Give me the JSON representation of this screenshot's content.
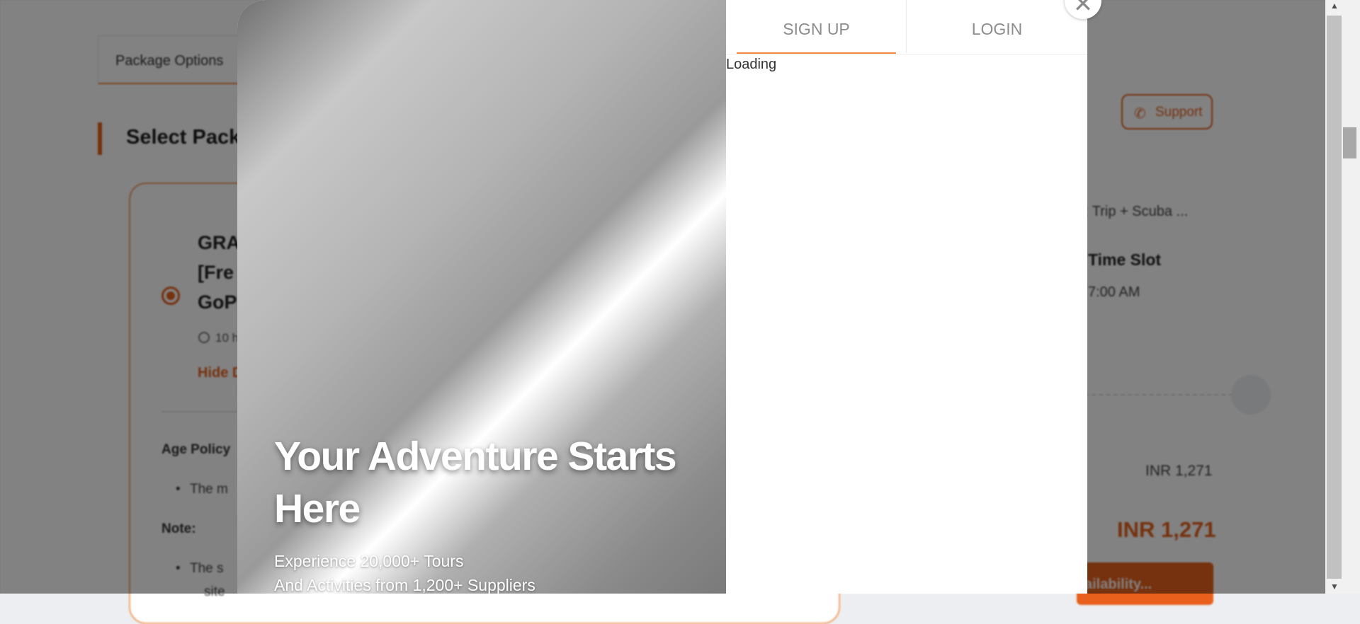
{
  "background_page": {
    "tab_label": "Package Options",
    "section_title": "Select Pack",
    "package_title": "GRA\n[Fre\nGoP",
    "duration": "10 h",
    "hide_link": "Hide D",
    "age_policy_heading": "Age Policy",
    "age_policy_item": "The m",
    "note_heading": "Note:",
    "note_item": "The s",
    "note_item_cont": "site",
    "support_label": "Support",
    "package_name_truncated": ": Trip + Scuba ...",
    "time_slot_heading": "Time Slot",
    "time_slot_value": "7:00 AM",
    "price_line": "INR 1,271",
    "price_total": "INR 1,271",
    "availability_button": "ailability..."
  },
  "modal": {
    "hero": {
      "title": "Your Adventure Starts Here",
      "subtitle_line1": "Experience 20,000+ Tours",
      "subtitle_line2": "And Activities from 1,200+ Suppliers"
    },
    "tabs": {
      "signup": "SIGN UP",
      "login": "LOGIN"
    },
    "loading_text": "Loading",
    "close_icon": "✕"
  },
  "colors": {
    "accent": "#e8601c",
    "tab_underline": "#f08a43",
    "overlay": "rgba(0,0,0,0.49)"
  },
  "icons": [
    "close-icon",
    "phone-icon",
    "clock-icon"
  ]
}
